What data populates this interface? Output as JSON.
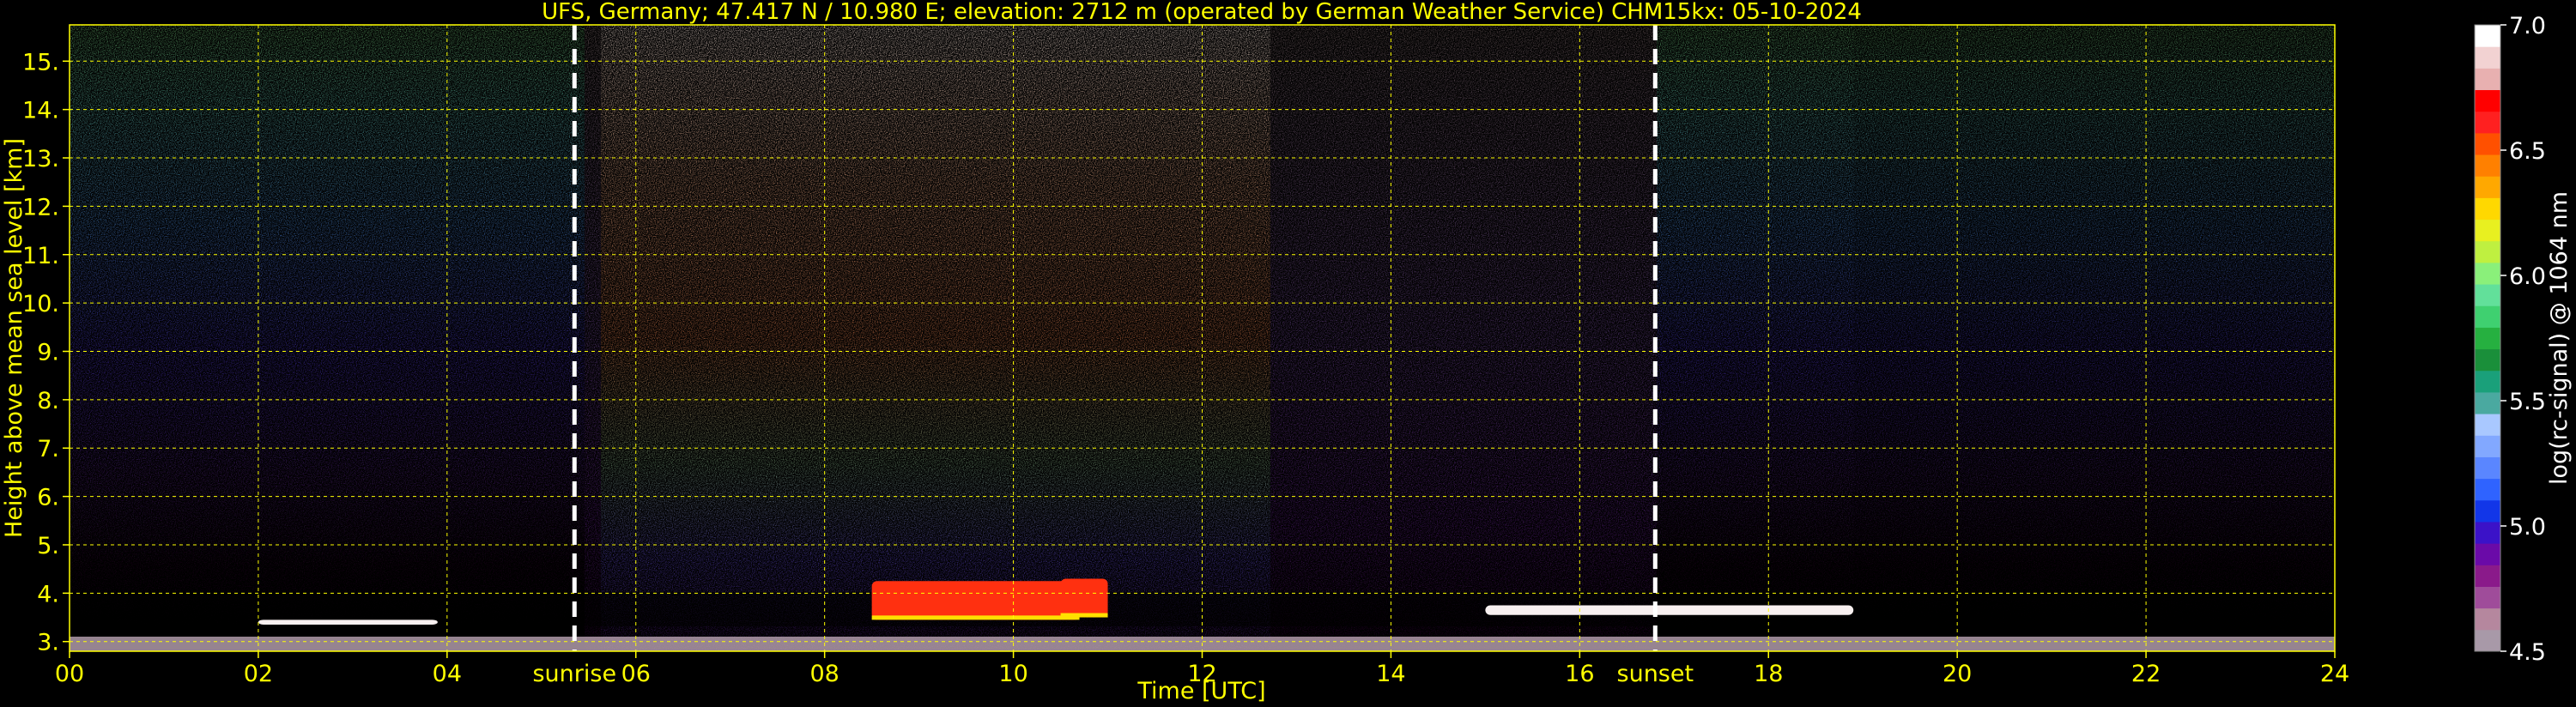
{
  "chart_data": {
    "type": "heatmap",
    "title": "UFS, Germany; 47.417 N / 10.980 E; elevation: 2712 m  (operated by German Weather Service)    CHM15kx: 05-10-2024",
    "xlabel": "Time [UTC]",
    "ylabel": "Height above mean sea level [km]",
    "xlim": [
      0,
      24
    ],
    "ylim": [
      2.8,
      15.75
    ],
    "x_ticks": [
      "00",
      "02",
      "04",
      "06",
      "08",
      "10",
      "12",
      "14",
      "16",
      "18",
      "20",
      "22",
      "24"
    ],
    "y_ticks": [
      "3.",
      "4.",
      "5.",
      "6.",
      "7.",
      "8.",
      "9.",
      "10.",
      "11.",
      "12.",
      "13.",
      "14.",
      "15."
    ],
    "grid": true,
    "events": [
      {
        "label": "sunrise",
        "x": 5.35
      },
      {
        "label": "sunset",
        "x": 16.8
      }
    ],
    "colorbar": {
      "label": "log(rc-signal) @ 1064 nm",
      "range": [
        4.5,
        7.0
      ],
      "ticks": [
        "4.5",
        "5.0",
        "5.5",
        "6.0",
        "6.5",
        "7.0"
      ],
      "colors": [
        "#a899a8",
        "#b5879e",
        "#9f4c9a",
        "#8a1a8a",
        "#6a0aa8",
        "#3b12c8",
        "#1236e8",
        "#2f63ff",
        "#5a86ff",
        "#82a8ff",
        "#a9c8ff",
        "#4aa9a0",
        "#1aa07a",
        "#1a8f3a",
        "#26b040",
        "#3fd070",
        "#62e09a",
        "#8af07a",
        "#bff040",
        "#e8f020",
        "#ffd800",
        "#ffa800",
        "#ff8000",
        "#ff5000",
        "#ff2020",
        "#ff0000",
        "#e8b0b0",
        "#f2d2d2",
        "#ffffff"
      ]
    },
    "cloud_layers": [
      {
        "x": [
          8.5,
          10.7
        ],
        "y": [
          3.45,
          4.25
        ],
        "level": "high"
      },
      {
        "x": [
          10.5,
          11.0
        ],
        "y": [
          3.5,
          4.3
        ],
        "level": "high"
      },
      {
        "x": [
          15.0,
          18.9
        ],
        "y": [
          3.55,
          3.75
        ],
        "level": "max"
      },
      {
        "x": [
          2.0,
          3.9
        ],
        "y": [
          3.35,
          3.45
        ],
        "level": "max"
      }
    ]
  }
}
